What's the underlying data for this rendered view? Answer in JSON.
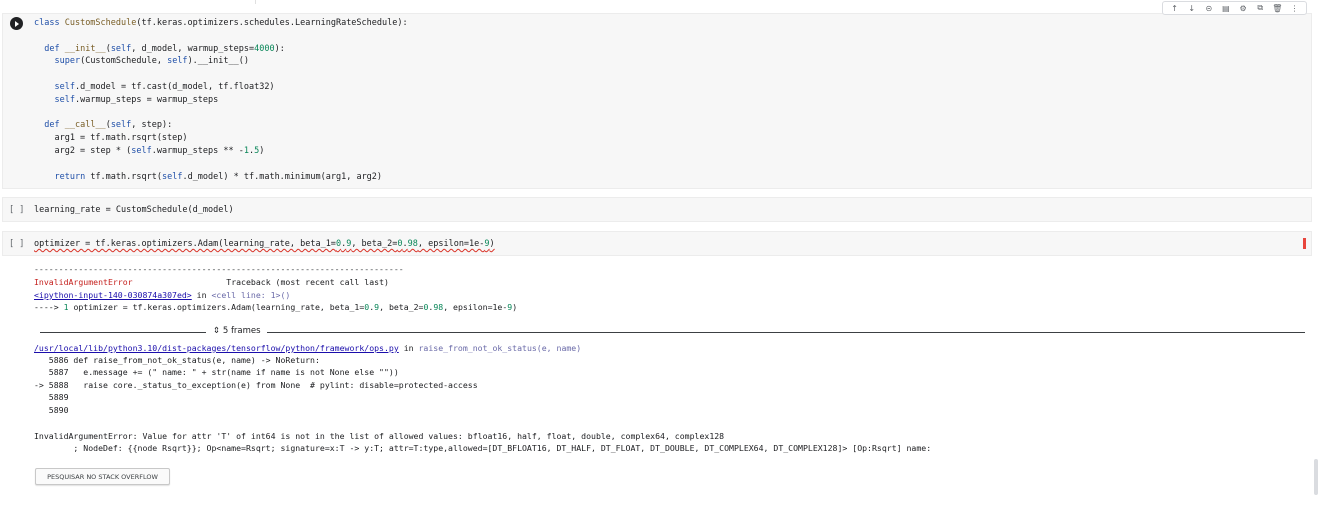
{
  "toolbar": {
    "icons": [
      "arrow-up-icon",
      "arrow-down-icon",
      "link-icon",
      "comment-icon",
      "gear-icon",
      "mirror-cell-icon",
      "trash-icon",
      "more-vert-icon"
    ],
    "glyphs": [
      "↑",
      "↓",
      "⊝",
      "▤",
      "⚙",
      "⧉",
      "🗑",
      "⋮"
    ]
  },
  "cells": {
    "cell1": {
      "lines": [
        "class CustomSchedule(tf.keras.optimizers.schedules.LearningRateSchedule):",
        "",
        "  def __init__(self, d_model, warmup_steps=4000):",
        "    super(CustomSchedule, self).__init__()",
        "",
        "    self.d_model = tf.cast(d_model, tf.float32)",
        "    self.warmup_steps = warmup_steps",
        "",
        "  def __call__(self, step):",
        "    arg1 = tf.math.rsqrt(step)",
        "    arg2 = step * (self.warmup_steps ** -1.5)",
        "",
        "    return tf.math.rsqrt(self.d_model) * tf.math.minimum(arg1, arg2)"
      ]
    },
    "cell2": {
      "bracket": "[ ]",
      "code": "learning_rate = CustomSchedule(d_model)"
    },
    "cell3": {
      "bracket": "[ ]",
      "code": "optimizer = tf.keras.optimizers.Adam(learning_rate, beta_1=0.9, beta_2=0.98, epsilon=1e-9)"
    }
  },
  "output": {
    "dashes": "---------------------------------------------------------------------------",
    "error_name": "InvalidArgumentError",
    "traceback_label": "Traceback (most recent call last)",
    "input_link": "<ipython-input-140-030874a307ed>",
    "in_text": " in ",
    "cell_line": "<cell line: 1>()",
    "arrow_line": "----> 1 optimizer = tf.keras.optimizers.Adam(learning_rate, beta_1=0.9, beta_2=0.98, epsilon=1e-9)",
    "frames_label": "5 frames",
    "file_link": "/usr/local/lib/python3.10/dist-packages/tensorflow/python/framework/ops.py",
    "func": "raise_from_not_ok_status(e, name)",
    "src_lines": [
      "   5886 def raise_from_not_ok_status(e, name) -> NoReturn:",
      "   5887   e.message += (\" name: \" + str(name if name is not None else \"\"))",
      "-> 5888   raise core._status_to_exception(e) from None  # pylint: disable=protected-access",
      "   5889",
      "   5890"
    ],
    "final_error_1": "InvalidArgumentError: Value for attr 'T' of int64 is not in the list of allowed values: bfloat16, half, float, double, complex64, complex128",
    "final_error_2": "        ; NodeDef: {{node Rsqrt}}; Op<name=Rsqrt; signature=x:T -> y:T; attr=T:type,allowed=[DT_BFLOAT16, DT_HALF, DT_FLOAT, DT_DOUBLE, DT_COMPLEX64, DT_COMPLEX128]> [Op:Rsqrt] name:",
    "stackoverflow_button": "PESQUISAR NO STACK OVERFLOW"
  }
}
